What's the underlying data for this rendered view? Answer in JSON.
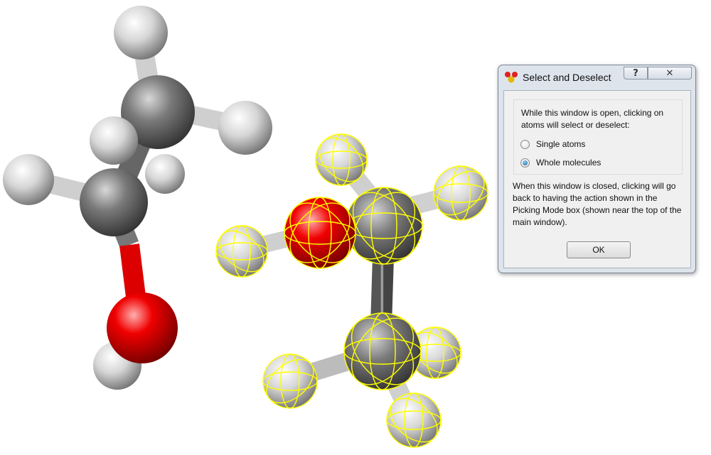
{
  "dialog": {
    "title": "Select and Deselect",
    "help_label": "?",
    "close_label": "✕",
    "intro_text": "While this window is open, clicking on atoms will select or deselect:",
    "options": [
      {
        "label": "Single atoms",
        "selected": false
      },
      {
        "label": "Whole molecules",
        "selected": true
      }
    ],
    "note_text": "When this window is closed, clicking will go back to having the action shown in the Picking Mode box (shown near the top of the main window).",
    "ok_label": "OK"
  },
  "viewer": {
    "molecules": [
      {
        "name": "ethanol",
        "selected": false
      },
      {
        "name": "ethanol",
        "selected": true
      }
    ],
    "colors": {
      "carbon": "#6e6e6e",
      "hydrogen": "#d2d2d2",
      "oxygen": "#dd0000",
      "selection": "#ffff00"
    }
  }
}
